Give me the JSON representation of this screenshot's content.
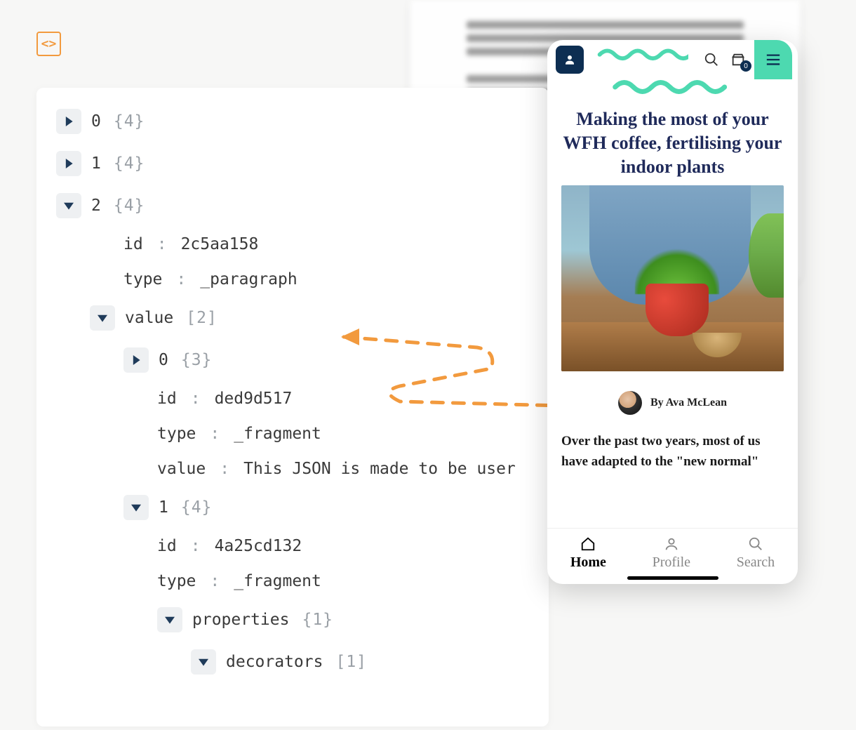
{
  "logo": {
    "glyph": "<>"
  },
  "tree": {
    "r0": {
      "key": "0",
      "brace": "{4}"
    },
    "r1": {
      "key": "1",
      "brace": "{4}"
    },
    "r2": {
      "key": "2",
      "brace": "{4}"
    },
    "r2_id_k": "id",
    "r2_id_v": "2c5aa158",
    "r2_type_k": "type",
    "r2_type_v": "_paragraph",
    "r2_value_k": "value",
    "r2_value_b": "[2]",
    "v0_k": "0",
    "v0_b": "{3}",
    "v0_id_k": "id",
    "v0_id_v": "ded9d517",
    "v0_type_k": "type",
    "v0_type_v": "_fragment",
    "v0_value_k": "value",
    "v0_value_v": "This JSON is made to be user",
    "v1_k": "1",
    "v1_b": "{4}",
    "v1_id_k": "id",
    "v1_id_v": "4a25cd132",
    "v1_type_k": "type",
    "v1_type_v": "_fragment",
    "v1_props_k": "properties",
    "v1_props_b": "{1}",
    "v1_dec_k": "decorators",
    "v1_dec_b": "[1]"
  },
  "phone": {
    "bag_count": "0",
    "title": "Making the most of your WFH coffee, fertilising your indoor plants",
    "byline": "By Ava McLean",
    "body": "Over the past two years, most of us have adapted to the \"new normal\"",
    "tabs": {
      "home": "Home",
      "profile": "Profile",
      "search": "Search"
    }
  }
}
